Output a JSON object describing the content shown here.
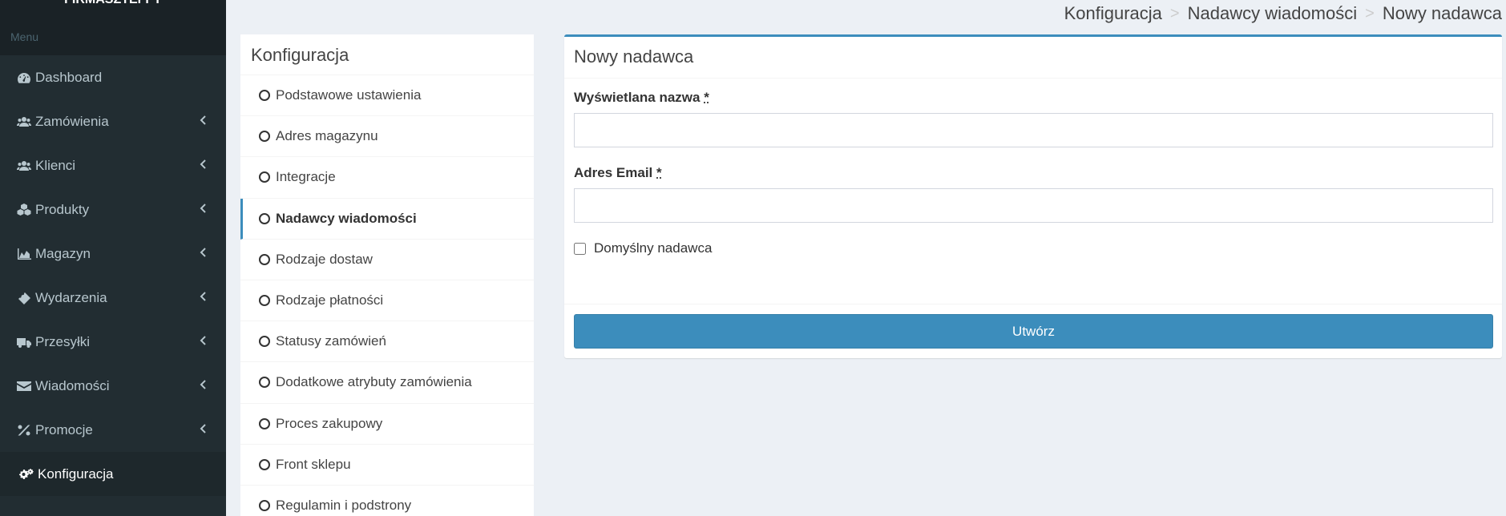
{
  "brand": "FIRMASZTEFFY",
  "menu_header": "Menu",
  "sidebar": {
    "items": [
      {
        "label": "Dashboard",
        "icon": "dashboard-icon"
      },
      {
        "label": "Zamówienia",
        "icon": "users-icon"
      },
      {
        "label": "Klienci",
        "icon": "users-icon"
      },
      {
        "label": "Produkty",
        "icon": "cubes-icon"
      },
      {
        "label": "Magazyn",
        "icon": "area-chart-icon"
      },
      {
        "label": "Wydarzenia",
        "icon": "ticket-icon"
      },
      {
        "label": "Przesyłki",
        "icon": "truck-icon"
      },
      {
        "label": "Wiadomości",
        "icon": "envelope-icon"
      },
      {
        "label": "Promocje",
        "icon": "percent-icon"
      },
      {
        "label": "Konfiguracja",
        "icon": "cogs-icon",
        "active": true
      }
    ]
  },
  "breadcrumb": [
    "Konfiguracja",
    "Nadawcy wiadomości",
    "Nowy nadawca"
  ],
  "breadcrumb_separator": ">",
  "config": {
    "title": "Konfiguracja",
    "items": [
      "Podstawowe ustawienia",
      "Adres magazynu",
      "Integracje",
      "Nadawcy wiadomości",
      "Rodzaje dostaw",
      "Rodzaje płatności",
      "Statusy zamówień",
      "Dodatkowe atrybuty zamówienia",
      "Proces zakupowy",
      "Front sklepu",
      "Regulamin i podstrony"
    ],
    "active_item": "Nadawcy wiadomości"
  },
  "form": {
    "title": "Nowy nadawca",
    "name_label": "Wyświetlana nazwa",
    "name_value": "",
    "email_label": "Adres Email",
    "email_value": "",
    "required_mark": "*",
    "default_sender_label": "Domyślny nadawca",
    "default_sender_checked": false,
    "submit_label": "Utwórz"
  },
  "colors": {
    "sidebar_bg": "#222d32",
    "accent": "#3c8dbc",
    "page_bg": "#ecf0f5"
  }
}
